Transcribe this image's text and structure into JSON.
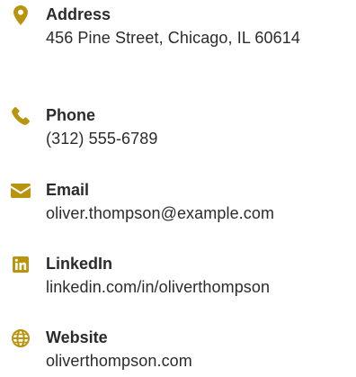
{
  "accent_color": "#b8940f",
  "contacts": [
    {
      "icon": "map-pin-icon",
      "label": "Address",
      "value": "456 Pine Street, Chicago, IL 60614"
    },
    {
      "icon": "phone-icon",
      "label": "Phone",
      "value": "(312) 555-6789"
    },
    {
      "icon": "envelope-icon",
      "label": "Email",
      "value": "oliver.thompson@example.com"
    },
    {
      "icon": "linkedin-icon",
      "label": "LinkedIn",
      "value": "linkedin.com/in/oliverthompson"
    },
    {
      "icon": "globe-icon",
      "label": "Website",
      "value": "oliverthompson.com"
    }
  ]
}
